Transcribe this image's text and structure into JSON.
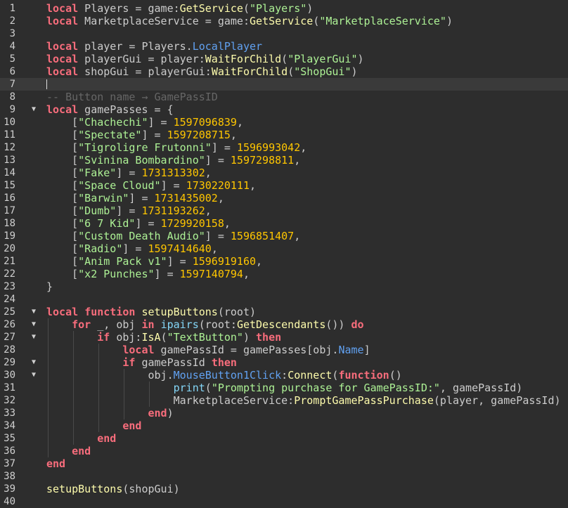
{
  "editor": {
    "current_line": 7,
    "fold_icon": "triangle-down-icon",
    "lines": [
      {
        "n": "1",
        "tokens": [
          [
            "kw",
            "local"
          ],
          [
            "txt",
            " Players = "
          ],
          [
            "txt",
            "game"
          ],
          [
            "txt",
            ":"
          ],
          [
            "fn",
            "GetService"
          ],
          [
            "txt",
            "("
          ],
          [
            "str",
            "\"Players\""
          ],
          [
            "txt",
            ")"
          ]
        ]
      },
      {
        "n": "2",
        "tokens": [
          [
            "kw",
            "local"
          ],
          [
            "txt",
            " MarketplaceService = "
          ],
          [
            "txt",
            "game"
          ],
          [
            "txt",
            ":"
          ],
          [
            "fn",
            "GetService"
          ],
          [
            "txt",
            "("
          ],
          [
            "str",
            "\"MarketplaceService\""
          ],
          [
            "txt",
            ")"
          ]
        ]
      },
      {
        "n": "3",
        "tokens": []
      },
      {
        "n": "4",
        "tokens": [
          [
            "kw",
            "local"
          ],
          [
            "txt",
            " player = Players."
          ],
          [
            "prop",
            "LocalPlayer"
          ]
        ]
      },
      {
        "n": "5",
        "tokens": [
          [
            "kw",
            "local"
          ],
          [
            "txt",
            " playerGui = player:"
          ],
          [
            "fn",
            "WaitForChild"
          ],
          [
            "txt",
            "("
          ],
          [
            "str",
            "\"PlayerGui\""
          ],
          [
            "txt",
            ")"
          ]
        ]
      },
      {
        "n": "6",
        "tokens": [
          [
            "kw",
            "local"
          ],
          [
            "txt",
            " shopGui = playerGui:"
          ],
          [
            "fn",
            "WaitForChild"
          ],
          [
            "txt",
            "("
          ],
          [
            "str",
            "\"ShopGui\""
          ],
          [
            "txt",
            ")"
          ]
        ]
      },
      {
        "n": "7",
        "tokens": []
      },
      {
        "n": "8",
        "tokens": [
          [
            "com",
            "-- Button name → GamePassID"
          ]
        ]
      },
      {
        "n": "9",
        "fold": true,
        "tokens": [
          [
            "kw",
            "local"
          ],
          [
            "txt",
            " gamePasses = {"
          ]
        ]
      },
      {
        "n": "10",
        "tokens": [
          [
            "txt",
            "    ["
          ],
          [
            "str",
            "\"Chachechi\""
          ],
          [
            "txt",
            "] = "
          ],
          [
            "num",
            "1597096839"
          ],
          [
            "txt",
            ","
          ]
        ]
      },
      {
        "n": "11",
        "tokens": [
          [
            "txt",
            "    ["
          ],
          [
            "str",
            "\"Spectate\""
          ],
          [
            "txt",
            "] = "
          ],
          [
            "num",
            "1597208715"
          ],
          [
            "txt",
            ","
          ]
        ]
      },
      {
        "n": "12",
        "tokens": [
          [
            "txt",
            "    ["
          ],
          [
            "str",
            "\"Tigroligre Frutonni\""
          ],
          [
            "txt",
            "] = "
          ],
          [
            "num",
            "1596993042"
          ],
          [
            "txt",
            ","
          ]
        ]
      },
      {
        "n": "13",
        "tokens": [
          [
            "txt",
            "    ["
          ],
          [
            "str",
            "\"Svinina Bombardino\""
          ],
          [
            "txt",
            "] = "
          ],
          [
            "num",
            "1597298811"
          ],
          [
            "txt",
            ","
          ]
        ]
      },
      {
        "n": "14",
        "tokens": [
          [
            "txt",
            "    ["
          ],
          [
            "str",
            "\"Fake\""
          ],
          [
            "txt",
            "] = "
          ],
          [
            "num",
            "1731313302"
          ],
          [
            "txt",
            ","
          ]
        ]
      },
      {
        "n": "15",
        "tokens": [
          [
            "txt",
            "    ["
          ],
          [
            "str",
            "\"Space Cloud\""
          ],
          [
            "txt",
            "] = "
          ],
          [
            "num",
            "1730220111"
          ],
          [
            "txt",
            ","
          ]
        ]
      },
      {
        "n": "16",
        "tokens": [
          [
            "txt",
            "    ["
          ],
          [
            "str",
            "\"Barwin\""
          ],
          [
            "txt",
            "] = "
          ],
          [
            "num",
            "1731435002"
          ],
          [
            "txt",
            ","
          ]
        ]
      },
      {
        "n": "17",
        "tokens": [
          [
            "txt",
            "    ["
          ],
          [
            "str",
            "\"Dumb\""
          ],
          [
            "txt",
            "] = "
          ],
          [
            "num",
            "1731193262"
          ],
          [
            "txt",
            ","
          ]
        ]
      },
      {
        "n": "18",
        "tokens": [
          [
            "txt",
            "    ["
          ],
          [
            "str",
            "\"6 7 Kid\""
          ],
          [
            "txt",
            "] = "
          ],
          [
            "num",
            "1729920158"
          ],
          [
            "txt",
            ","
          ]
        ]
      },
      {
        "n": "19",
        "tokens": [
          [
            "txt",
            "    ["
          ],
          [
            "str",
            "\"Custom Death Audio\""
          ],
          [
            "txt",
            "] = "
          ],
          [
            "num",
            "1596851407"
          ],
          [
            "txt",
            ","
          ]
        ]
      },
      {
        "n": "20",
        "tokens": [
          [
            "txt",
            "    ["
          ],
          [
            "str",
            "\"Radio\""
          ],
          [
            "txt",
            "] = "
          ],
          [
            "num",
            "1597414640"
          ],
          [
            "txt",
            ","
          ]
        ]
      },
      {
        "n": "21",
        "tokens": [
          [
            "txt",
            "    ["
          ],
          [
            "str",
            "\"Anim Pack v1\""
          ],
          [
            "txt",
            "] = "
          ],
          [
            "num",
            "1596919160"
          ],
          [
            "txt",
            ","
          ]
        ]
      },
      {
        "n": "22",
        "tokens": [
          [
            "txt",
            "    ["
          ],
          [
            "str",
            "\"x2 Punches\""
          ],
          [
            "txt",
            "] = "
          ],
          [
            "num",
            "1597140794"
          ],
          [
            "txt",
            ","
          ]
        ]
      },
      {
        "n": "23",
        "tokens": [
          [
            "txt",
            "}"
          ]
        ]
      },
      {
        "n": "24",
        "tokens": []
      },
      {
        "n": "25",
        "fold": true,
        "tokens": [
          [
            "kw",
            "local"
          ],
          [
            "txt",
            " "
          ],
          [
            "kw",
            "function"
          ],
          [
            "txt",
            " "
          ],
          [
            "fn",
            "setupButtons"
          ],
          [
            "txt",
            "(root)"
          ]
        ]
      },
      {
        "n": "26",
        "fold": true,
        "tokens": [
          [
            "txt",
            "    "
          ],
          [
            "kw",
            "for"
          ],
          [
            "txt",
            " _, obj "
          ],
          [
            "kw",
            "in"
          ],
          [
            "txt",
            " "
          ],
          [
            "bi",
            "ipairs"
          ],
          [
            "txt",
            "(root:"
          ],
          [
            "fn",
            "GetDescendants"
          ],
          [
            "txt",
            "()) "
          ],
          [
            "kw",
            "do"
          ]
        ]
      },
      {
        "n": "27",
        "fold": true,
        "tokens": [
          [
            "txt",
            "        "
          ],
          [
            "kw",
            "if"
          ],
          [
            "txt",
            " obj:"
          ],
          [
            "fn",
            "IsA"
          ],
          [
            "txt",
            "("
          ],
          [
            "str",
            "\"TextButton\""
          ],
          [
            "txt",
            ") "
          ],
          [
            "kw",
            "then"
          ]
        ]
      },
      {
        "n": "28",
        "tokens": [
          [
            "txt",
            "            "
          ],
          [
            "kw",
            "local"
          ],
          [
            "txt",
            " gamePassId = gamePasses[obj."
          ],
          [
            "prop",
            "Name"
          ],
          [
            "txt",
            "]"
          ]
        ]
      },
      {
        "n": "29",
        "fold": true,
        "tokens": [
          [
            "txt",
            "            "
          ],
          [
            "kw",
            "if"
          ],
          [
            "txt",
            " gamePassId "
          ],
          [
            "kw",
            "then"
          ]
        ]
      },
      {
        "n": "30",
        "fold": true,
        "tokens": [
          [
            "txt",
            "                obj."
          ],
          [
            "prop",
            "MouseButton1Click"
          ],
          [
            "txt",
            ":"
          ],
          [
            "fn",
            "Connect"
          ],
          [
            "txt",
            "("
          ],
          [
            "kw",
            "function"
          ],
          [
            "txt",
            "()"
          ]
        ]
      },
      {
        "n": "31",
        "tokens": [
          [
            "txt",
            "                    "
          ],
          [
            "bi",
            "print"
          ],
          [
            "txt",
            "("
          ],
          [
            "str",
            "\"Prompting purchase for GamePassID:\""
          ],
          [
            "txt",
            ", gamePassId)"
          ]
        ]
      },
      {
        "n": "32",
        "tokens": [
          [
            "txt",
            "                    MarketplaceService:"
          ],
          [
            "fn",
            "PromptGamePassPurchase"
          ],
          [
            "txt",
            "(player, gamePassId)"
          ]
        ]
      },
      {
        "n": "33",
        "tokens": [
          [
            "txt",
            "                "
          ],
          [
            "kw",
            "end"
          ],
          [
            "txt",
            ")"
          ]
        ]
      },
      {
        "n": "34",
        "tokens": [
          [
            "txt",
            "            "
          ],
          [
            "kw",
            "end"
          ]
        ]
      },
      {
        "n": "35",
        "tokens": [
          [
            "txt",
            "        "
          ],
          [
            "kw",
            "end"
          ]
        ]
      },
      {
        "n": "36",
        "tokens": [
          [
            "txt",
            "    "
          ],
          [
            "kw",
            "end"
          ]
        ]
      },
      {
        "n": "37",
        "tokens": [
          [
            "kw",
            "end"
          ]
        ]
      },
      {
        "n": "38",
        "tokens": []
      },
      {
        "n": "39",
        "tokens": [
          [
            "fn",
            "setupButtons"
          ],
          [
            "txt",
            "(shopGui)"
          ]
        ]
      },
      {
        "n": "40",
        "tokens": []
      }
    ]
  }
}
